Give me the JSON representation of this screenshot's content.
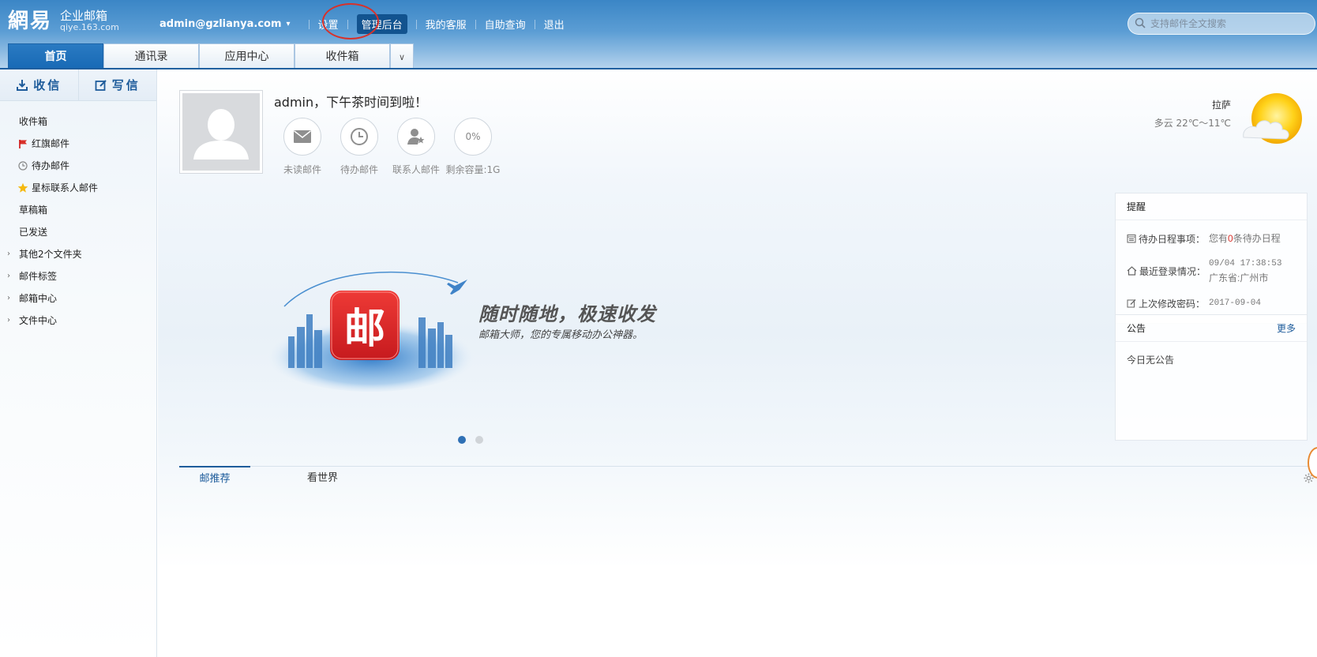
{
  "header": {
    "logo_text": "網易",
    "logo_sub": "企业邮箱",
    "logo_domain": "qiye.163.com",
    "user": "admin@gzlianya.com",
    "links": [
      "设置",
      "管理后台",
      "我的客服",
      "自助查询",
      "退出"
    ],
    "search_placeholder": "支持邮件全文搜索"
  },
  "tabs": [
    "首页",
    "通讯录",
    "应用中心",
    "收件箱"
  ],
  "sidebar": {
    "receive_label": "收信",
    "compose_label": "写信",
    "folders": [
      {
        "label": "收件箱",
        "icon": "none"
      },
      {
        "label": "红旗邮件",
        "icon": "red-flag-icon"
      },
      {
        "label": "待办邮件",
        "icon": "clock-icon"
      },
      {
        "label": "星标联系人邮件",
        "icon": "star-icon"
      },
      {
        "label": "草稿箱",
        "icon": "none"
      },
      {
        "label": "已发送",
        "icon": "none"
      }
    ],
    "groups": [
      "其他2个文件夹",
      "邮件标签",
      "邮箱中心",
      "文件中心"
    ]
  },
  "welcome": {
    "greeting": "admin，下午茶时间到啦！",
    "stats": [
      {
        "label": "未读邮件",
        "icon": "envelope-icon"
      },
      {
        "label": "待办邮件",
        "icon": "clock-icon"
      },
      {
        "label": "联系人邮件",
        "icon": "contact-star-icon"
      },
      {
        "label": "剩余容量:1G",
        "value": "0%"
      }
    ]
  },
  "weather": {
    "city": "拉萨",
    "desc": "多云 22℃～11℃"
  },
  "banner": {
    "title": "随时随地，极速收发",
    "subtitle": "邮箱大师，您的专属移动办公神器。",
    "app_icon_text": "邮"
  },
  "remind": {
    "title": "提醒",
    "todo_label": "待办日程事项：",
    "todo_prefix": "您有",
    "todo_count": "0",
    "todo_suffix": "条待办日程",
    "login_label": "最近登录情况：",
    "login_time": "09/04 17:38:53",
    "login_place": "广东省:广州市",
    "pwd_label": "上次修改密码：",
    "pwd_date": "2017-09-04"
  },
  "notice": {
    "title": "公告",
    "more": "更多",
    "body": "今日无公告"
  },
  "bottom_tabs": [
    "邮推荐",
    "看世界"
  ],
  "colors": {
    "accent": "#1e5c9b",
    "header": "#3b86c6",
    "highlight_circle": "#d8312a",
    "banner_icon": "#d9232a"
  }
}
